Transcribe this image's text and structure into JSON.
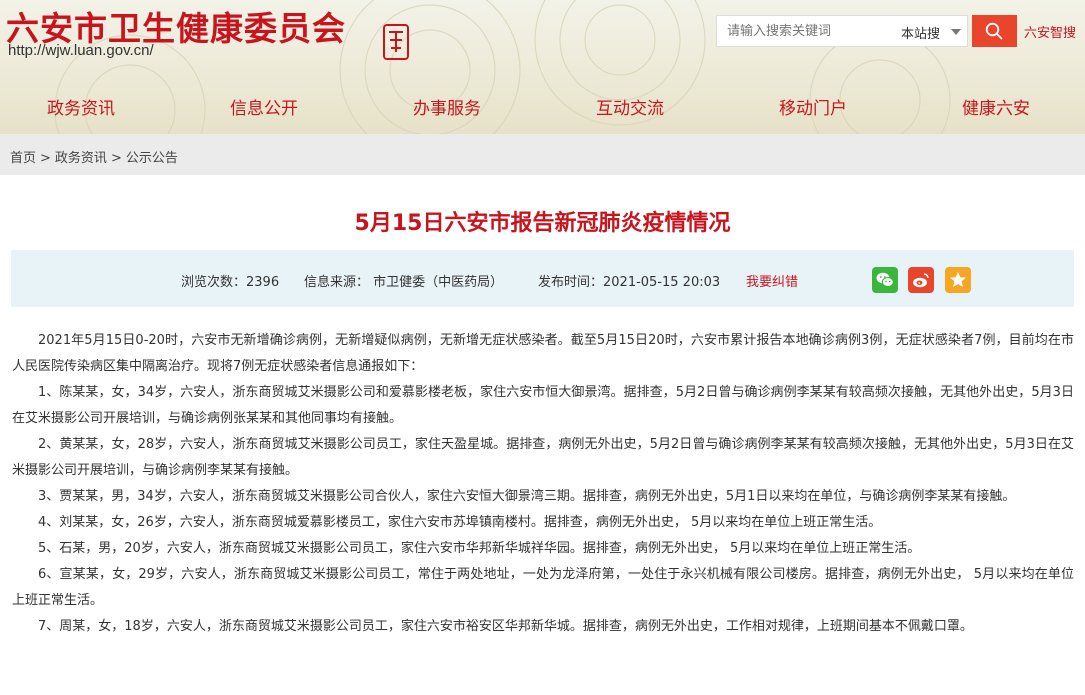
{
  "site": {
    "title": "六安市卫生健康委员会",
    "url": "http://wjw.luan.gov.cn/"
  },
  "search": {
    "placeholder": "请输入搜索关键词",
    "scope": "本站搜",
    "smart_link": "六安智搜"
  },
  "nav": {
    "items": [
      "政务资讯",
      "信息公开",
      "办事服务",
      "互动交流",
      "移动门户",
      "健康六安"
    ]
  },
  "breadcrumb": {
    "items": [
      "首页",
      "政务资讯",
      "公示公告"
    ]
  },
  "article": {
    "title": "5月15日六安市报告新冠肺炎疫情情况",
    "views": "浏览次数：2396",
    "source": "信息来源： 市卫健委（中医药局）",
    "published": "发布时间：2021-05-15 20:03",
    "correction": "我要纠错",
    "paragraphs": [
      "2021年5月15日0-20时，六安市无新增确诊病例，无新增疑似病例，无新增无症状感染者。截至5月15日20时，六安市累计报告本地确诊病例3例，无症状感染者7例，目前均在市人民医院传染病区集中隔离治疗。现将7例无症状感染者信息通报如下：",
      "1、陈某某，女，34岁，六安人，浙东商贸城艾米摄影公司和爱慕影楼老板，家住六安市恒大御景湾。据排查，5月2日曾与确诊病例李某某有较高频次接触，无其他外出史，5月3日在艾米摄影公司开展培训，与确诊病例张某某和其他同事均有接触。",
      "2、黄某某，女，28岁，六安人，浙东商贸城艾米摄影公司员工，家住天盈星城。据排查，病例无外出史，5月2日曾与确诊病例李某某有较高频次接触，无其他外出史，5月3日在艾米摄影公司开展培训，与确诊病例李某某有接触。",
      "3、贾某某，男，34岁，六安人，浙东商贸城艾米摄影公司合伙人，家住六安恒大御景湾三期。据排查，病例无外出史，5月1日以来均在单位，与确诊病例李某某有接触。",
      "4、刘某某，女，26岁，六安人，浙东商贸城爱慕影楼员工，家住六安市苏埠镇南楼村。据排查，病例无外出史， 5月以来均在单位上班正常生活。",
      "5、石某，男，20岁，六安人，浙东商贸城艾米摄影公司员工，家住六安市华邦新华城祥华园。据排查，病例无外出史， 5月以来均在单位上班正常生活。",
      "6、宣某某，女，29岁，六安人，浙东商贸城艾米摄影公司员工，常住于两处地址，一处为龙泽府第，一处住于永兴机械有限公司楼房。据排查，病例无外出史， 5月以来均在单位上班正常生活。",
      "7、周某，女，18岁，六安人，浙东商贸城艾米摄影公司员工，家住六安市裕安区华邦新华城。据排查，病例无外出史，工作相对规律，上班期间基本不佩戴口罩。"
    ]
  },
  "share": {
    "icons": [
      "wechat-icon",
      "weibo-icon",
      "favorite-icon"
    ]
  },
  "colors": {
    "brand_red": "#c8151d",
    "search_button": "#e8452c",
    "wechat": "#3bb53b",
    "weibo": "#e8452c",
    "favorite": "#f5a623",
    "meta_bg": "#e8f3f8"
  }
}
